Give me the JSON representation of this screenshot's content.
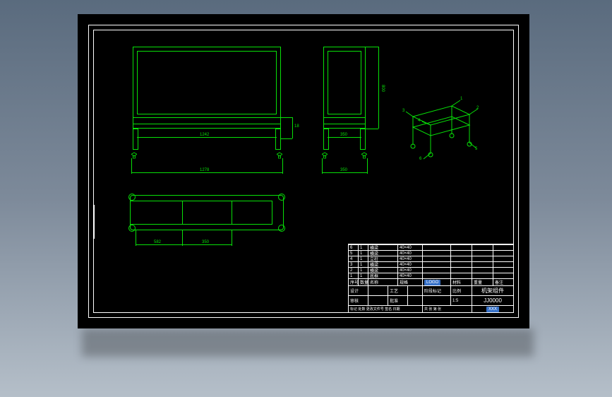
{
  "drawing": {
    "front": {
      "dimWidthInner": "1242",
      "dimWidthOuter": "1278",
      "dimHeightPanel": "18"
    },
    "side": {
      "dimWidth": "350",
      "dimWidthBase": "350",
      "dimHeight": "800"
    },
    "top": {
      "dimA": "582",
      "dimB": "350"
    },
    "iso": {
      "labels": [
        "1",
        "2",
        "3",
        "4",
        "5",
        "6"
      ]
    }
  },
  "titleblock": {
    "partsList": [
      {
        "no": "6",
        "qty": "1",
        "name": "横梁",
        "spec": "40×40",
        "mat": "",
        "note": ""
      },
      {
        "no": "5",
        "qty": "1",
        "name": "横梁",
        "spec": "40×40",
        "mat": "",
        "note": ""
      },
      {
        "no": "4",
        "qty": "1",
        "name": "立柱",
        "spec": "40×40",
        "mat": "",
        "note": ""
      },
      {
        "no": "3",
        "qty": "1",
        "name": "横梁",
        "spec": "40×40",
        "mat": "",
        "note": ""
      },
      {
        "no": "2",
        "qty": "1",
        "name": "横梁",
        "spec": "40×40",
        "mat": "",
        "note": ""
      },
      {
        "no": "1",
        "qty": "1",
        "name": "底框",
        "spec": "40×40",
        "mat": "",
        "note": ""
      }
    ],
    "headers": {
      "no": "序号",
      "qty": "数量",
      "name": "名称",
      "spec": "规格",
      "mat": "材料",
      "wt": "重量",
      "note": "备注"
    },
    "logoText": "LOGO",
    "companyBrand": "XXX",
    "col_material": "材料",
    "col_weight": "重量",
    "col_note": "备注",
    "field_design": "设计",
    "field_check": "审核",
    "field_process": "工艺",
    "field_approve": "批准",
    "stageMark": "阶段标记",
    "scaleLabel": "比例",
    "scale": "1:5",
    "sheetLabel": "共 张 第 张",
    "partName": "机架组件",
    "drawingNo": "JJ0000",
    "changeHeader": "标记 处数 更改文件号 签名 日期"
  },
  "sideStrip": [
    "",
    "",
    "",
    ""
  ]
}
